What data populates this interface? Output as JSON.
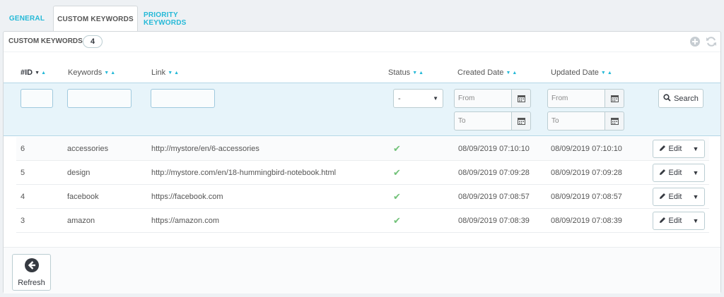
{
  "tabs": [
    {
      "label": "GENERAL",
      "active": false
    },
    {
      "label": "CUSTOM KEYWORDS",
      "active": true
    },
    {
      "label": "PRIORITY KEYWORDS",
      "active": false
    }
  ],
  "panel": {
    "title": "CUSTOM KEYWORDS",
    "count": "4",
    "icons": [
      "add-circle-icon",
      "refresh-list-icon"
    ]
  },
  "columns": {
    "id": "#ID",
    "keywords": "Keywords",
    "link": "Link",
    "status": "Status",
    "created": "Created Date",
    "updated": "Updated Date"
  },
  "filters": {
    "status_selected": "-",
    "created_from_placeholder": "From",
    "created_to_placeholder": "To",
    "updated_from_placeholder": "From",
    "updated_to_placeholder": "To",
    "search_label": "Search"
  },
  "rows": [
    {
      "id": "6",
      "keyword": "accessories",
      "link": "http://mystore/en/6-accessories",
      "status": "enabled",
      "created": "08/09/2019 07:10:10",
      "updated": "08/09/2019 07:10:10",
      "action": "Edit"
    },
    {
      "id": "5",
      "keyword": "design",
      "link": "http://mystore.com/en/18-hummingbird-notebook.html",
      "status": "enabled",
      "created": "08/09/2019 07:09:28",
      "updated": "08/09/2019 07:09:28",
      "action": "Edit"
    },
    {
      "id": "4",
      "keyword": "facebook",
      "link": "https://facebook.com",
      "status": "enabled",
      "created": "08/09/2019 07:08:57",
      "updated": "08/09/2019 07:08:57",
      "action": "Edit"
    },
    {
      "id": "3",
      "keyword": "amazon",
      "link": "https://amazon.com",
      "status": "enabled",
      "created": "08/09/2019 07:08:39",
      "updated": "08/09/2019 07:08:39",
      "action": "Edit"
    }
  ],
  "footer": {
    "refresh_label": "Refresh"
  },
  "colors": {
    "accent": "#25b9d7",
    "check": "#72c279",
    "filter_bg": "#e7f4fa"
  }
}
